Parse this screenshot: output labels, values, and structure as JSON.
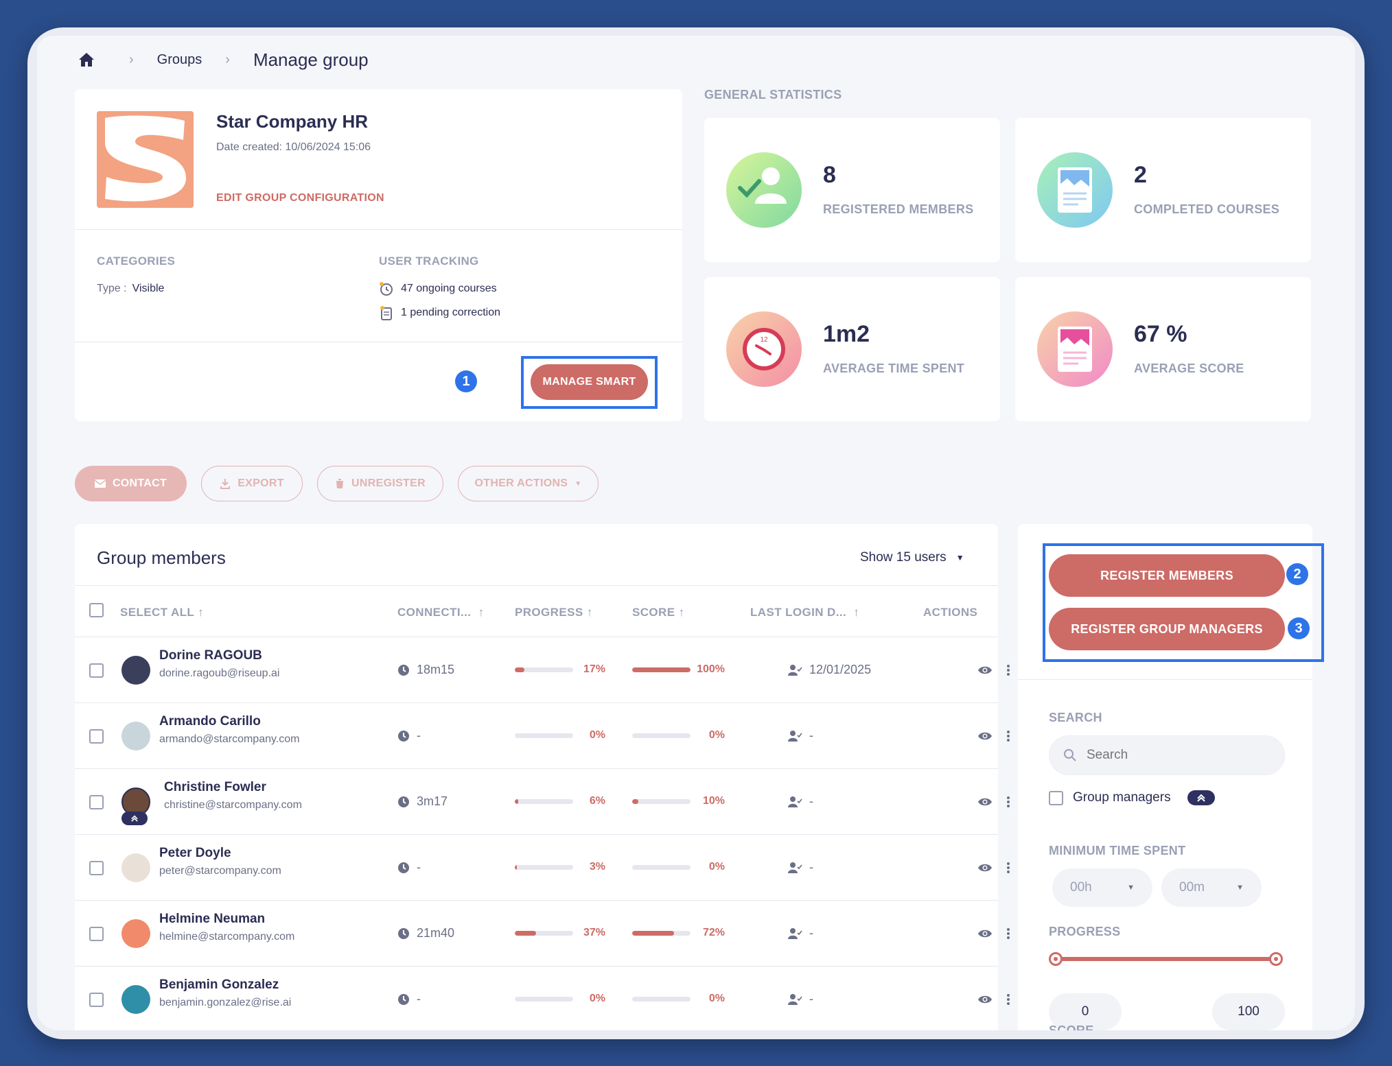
{
  "breadcrumb": {
    "home_icon": "home-icon",
    "groups": "Groups",
    "current": "Manage group"
  },
  "group": {
    "name": "Star Company HR",
    "date_created": "Date created: 10/06/2024 15:06",
    "edit_link": "EDIT GROUP CONFIGURATION",
    "categories_label": "CATEGORIES",
    "type_label": "Type :",
    "type_value": "Visible",
    "tracking_label": "USER TRACKING",
    "ongoing": "47 ongoing courses",
    "pending": "1 pending correction",
    "manage_button": "MANAGE SMART RULES",
    "logo_color": "#f3a282"
  },
  "statistics": {
    "title": "GENERAL STATISTICS",
    "cards": [
      {
        "value": "8",
        "label": "REGISTERED MEMBERS",
        "icon": "user-check-icon"
      },
      {
        "value": "2",
        "label": "COMPLETED COURSES",
        "icon": "course-icon"
      },
      {
        "value": "1m2",
        "label": "AVERAGE TIME SPENT",
        "icon": "clock-icon"
      },
      {
        "value": "67 %",
        "label": "AVERAGE SCORE",
        "icon": "score-icon"
      }
    ]
  },
  "actions": {
    "contact": "CONTACT",
    "export": "EXPORT",
    "unregister": "UNREGISTER",
    "other": "OTHER ACTIONS"
  },
  "members": {
    "title": "Group members",
    "show": "Show 15 users",
    "headers": {
      "select_all": "SELECT ALL",
      "connection": "CONNECTI...",
      "progress": "PROGRESS",
      "score": "SCORE",
      "last_login": "LAST LOGIN D...",
      "actions": "ACTIONS"
    },
    "rows": [
      {
        "name": "Dorine RAGOUB",
        "email": "dorine.ragoub@riseup.ai",
        "time": "18m15",
        "progress": 17,
        "progress_label": "17%",
        "score": 100,
        "score_label": "100%",
        "last_login": "12/01/2025"
      },
      {
        "name": "Armando Carillo",
        "email": "armando@starcompany.com",
        "time": "-",
        "progress": 0,
        "progress_label": "0%",
        "score": 0,
        "score_label": "0%",
        "last_login": "-"
      },
      {
        "name": "Christine Fowler",
        "email": "christine@starcompany.com",
        "time": "3m17",
        "progress": 6,
        "progress_label": "6%",
        "score": 10,
        "score_label": "10%",
        "last_login": "-",
        "manager": true
      },
      {
        "name": "Peter Doyle",
        "email": "peter@starcompany.com",
        "time": "-",
        "progress": 3,
        "progress_label": "3%",
        "score": 0,
        "score_label": "0%",
        "last_login": "-"
      },
      {
        "name": "Helmine Neuman",
        "email": "helmine@starcompany.com",
        "time": "21m40",
        "progress": 37,
        "progress_label": "37%",
        "score": 72,
        "score_label": "72%",
        "last_login": "-"
      },
      {
        "name": "Benjamin Gonzalez",
        "email": "benjamin.gonzalez@rise.ai",
        "time": "-",
        "progress": 0,
        "progress_label": "0%",
        "score": 0,
        "score_label": "0%",
        "last_login": "-"
      }
    ]
  },
  "panel": {
    "register_members": "REGISTER MEMBERS",
    "register_managers": "REGISTER GROUP MANAGERS",
    "search_label": "SEARCH",
    "search_placeholder": "Search",
    "group_managers": "Group managers",
    "min_time_label": "MINIMUM TIME SPENT",
    "hours": "00h",
    "minutes": "00m",
    "progress_label": "PROGRESS",
    "progress_min": "0",
    "progress_max": "100",
    "score_label": "SCORE"
  },
  "callouts": [
    "1",
    "2",
    "3"
  ],
  "colors": {
    "accent": "#cd6b66",
    "highlight": "#2e73e8",
    "background": "#2a4d8b"
  }
}
